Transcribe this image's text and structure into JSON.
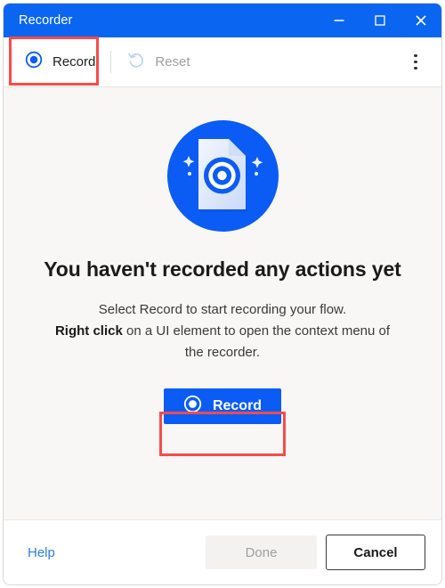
{
  "window": {
    "title": "Recorder",
    "accent_color": "#0a5cf5",
    "titlebar_color": "#0a66f0",
    "content_bg": "#f8f7f6",
    "controls": [
      {
        "name": "minimize",
        "icon": "minimize-icon"
      },
      {
        "name": "maximize",
        "icon": "maximize-icon"
      },
      {
        "name": "close",
        "icon": "close-icon"
      }
    ]
  },
  "toolbar": {
    "record_label": "Record",
    "record_icon": "record-circle-icon",
    "reset_label": "Reset",
    "reset_icon": "undo-arrow-icon",
    "reset_disabled": true,
    "overflow_icon": "more-vertical-icon"
  },
  "main": {
    "illustration_icon": "document-record-illustration",
    "headline": "You haven't recorded any actions yet",
    "subtext_line1": "Select Record to start recording your flow.",
    "subtext_bold": "Right click",
    "subtext_line2": " on a UI element to open the context menu of the recorder.",
    "primary_button_label": "Record",
    "primary_button_icon": "record-circle-icon"
  },
  "footer": {
    "help_label": "Help",
    "done_label": "Done",
    "done_disabled": true,
    "cancel_label": "Cancel"
  },
  "annotations": {
    "highlight_color": "#fa4b4b",
    "boxes": [
      {
        "name": "toolbar-record-highlight"
      },
      {
        "name": "primary-record-highlight"
      }
    ]
  }
}
